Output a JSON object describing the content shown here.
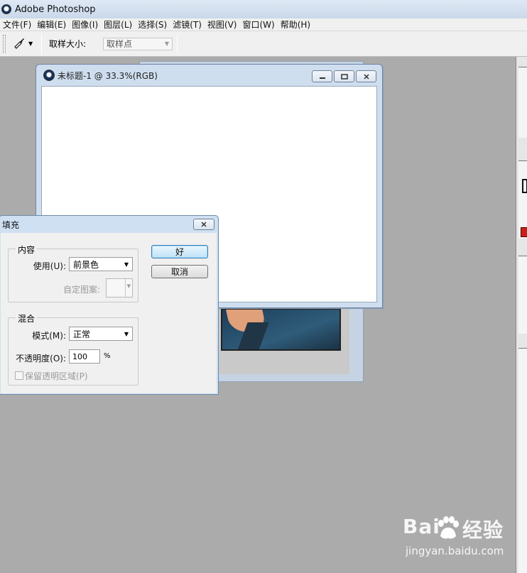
{
  "app": {
    "title": "Adobe Photoshop"
  },
  "menubar": {
    "items": [
      {
        "label": "文件(F)"
      },
      {
        "label": "编辑(E)"
      },
      {
        "label": "图像(I)"
      },
      {
        "label": "图层(L)"
      },
      {
        "label": "选择(S)"
      },
      {
        "label": "滤镜(T)"
      },
      {
        "label": "视图(V)"
      },
      {
        "label": "窗口(W)"
      },
      {
        "label": "帮助(H)"
      }
    ]
  },
  "options": {
    "tool_icon": "eyedropper-icon",
    "sample_size_label": "取样大小:",
    "sample_size_value": "取样点"
  },
  "document": {
    "title": "未标题-1 @ 33.3%(RGB)",
    "buttons": [
      "minimize-icon",
      "restore-icon",
      "close-icon"
    ]
  },
  "fill_dialog": {
    "title": "填充",
    "content_group": "内容",
    "use_label": "使用(U):",
    "use_value": "前景色",
    "custom_pattern_label": "自定图案:",
    "blend_group": "混合",
    "mode_label": "模式(M):",
    "mode_value": "正常",
    "opacity_label": "不透明度(O):",
    "opacity_value": "100",
    "opacity_unit": "%",
    "preserve_label": "保留透明区域(P)",
    "ok_label": "好",
    "cancel_label": "取消"
  },
  "watermark": {
    "brand_left": "Bai",
    "brand_right": "经验",
    "sub": "jingyan.baidu.com"
  }
}
